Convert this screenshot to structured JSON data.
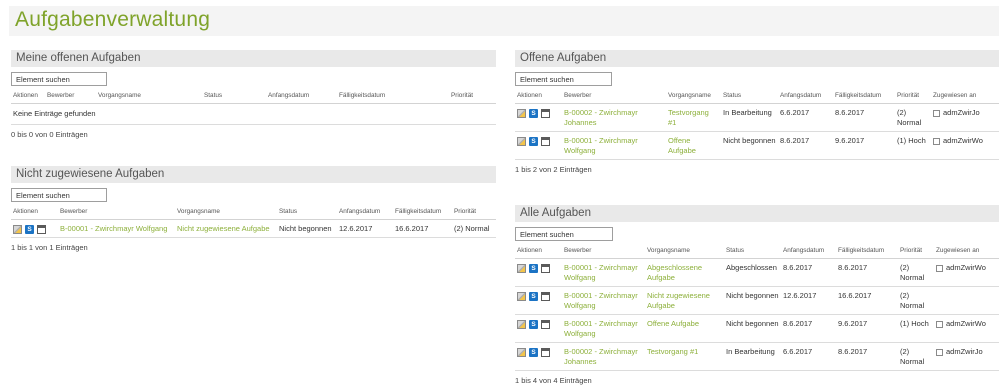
{
  "page": {
    "title": "Aufgabenverwaltung"
  },
  "my_tasks": {
    "title": "Meine offenen Aufgaben",
    "search_placeholder": "Element suchen",
    "columns": [
      "Aktionen",
      "Bewerber",
      "Vorgangsname",
      "Status",
      "Anfangsdatum",
      "Fälligkeitsdatum",
      "Priorität"
    ],
    "empty_text": "Keine Einträge gefunden",
    "footer": "0 bis 0 von 0 Einträgen"
  },
  "unassigned_tasks": {
    "title": "Nicht zugewiesene Aufgaben",
    "search_placeholder": "Element suchen",
    "columns": [
      "Aktionen",
      "Bewerber",
      "Vorgangsname",
      "Status",
      "Anfangsdatum",
      "Fälligkeitsdatum",
      "Priorität"
    ],
    "rows": [
      {
        "applicant": "B-00001 - Zwirchmayr Wolfgang",
        "process": "Nicht zugewiesene Aufgabe",
        "status": "Nicht begonnen",
        "start": "12.6.2017",
        "due": "16.6.2017",
        "priority": "(2) Normal"
      }
    ],
    "footer": "1 bis 1 von 1 Einträgen"
  },
  "open_tasks": {
    "title": "Offene Aufgaben",
    "search_placeholder": "Element suchen",
    "columns": [
      "Aktionen",
      "Bewerber",
      "Vorgangsname",
      "Status",
      "Anfangsdatum",
      "Fälligkeitsdatum",
      "Priorität",
      "Zugewiesen an"
    ],
    "rows": [
      {
        "applicant": "B-00002 - Zwirchmayr Johannes",
        "process": "Testvorgang #1",
        "status": "In Bearbeitung",
        "start": "6.6.2017",
        "due": "8.6.2017",
        "priority": "(2) Normal",
        "assigned": "admZwirJo"
      },
      {
        "applicant": "B-00001 - Zwirchmayr Wolfgang",
        "process": "Offene Aufgabe",
        "status": "Nicht begonnen",
        "start": "8.6.2017",
        "due": "9.6.2017",
        "priority": "(1) Hoch",
        "assigned": "admZwirWo"
      }
    ],
    "footer": "1 bis 2 von 2 Einträgen"
  },
  "all_tasks": {
    "title": "Alle Aufgaben",
    "search_placeholder": "Element suchen",
    "columns": [
      "Aktionen",
      "Bewerber",
      "Vorgangsname",
      "Status",
      "Anfangsdatum",
      "Fälligkeitsdatum",
      "Priorität",
      "Zugewiesen an"
    ],
    "rows": [
      {
        "applicant": "B-00001 - Zwirchmayr Wolfgang",
        "process": "Abgeschlossene Aufgabe",
        "status": "Abgeschlossen",
        "start": "8.6.2017",
        "due": "8.6.2017",
        "priority": "(2) Normal",
        "assigned": "admZwirWo"
      },
      {
        "applicant": "B-00001 - Zwirchmayr Wolfgang",
        "process": "Nicht zugewiesene Aufgabe",
        "status": "Nicht begonnen",
        "start": "12.6.2017",
        "due": "16.6.2017",
        "priority": "(2) Normal",
        "assigned": ""
      },
      {
        "applicant": "B-00001 - Zwirchmayr Wolfgang",
        "process": "Offene Aufgabe",
        "status": "Nicht begonnen",
        "start": "8.6.2017",
        "due": "9.6.2017",
        "priority": "(1) Hoch",
        "assigned": "admZwirWo"
      },
      {
        "applicant": "B-00002 - Zwirchmayr Johannes",
        "process": "Testvorgang #1",
        "status": "In Bearbeitung",
        "start": "6.6.2017",
        "due": "8.6.2017",
        "priority": "(2) Normal",
        "assigned": "admZwirJo"
      }
    ],
    "footer": "1 bis 4 von 4 Einträgen"
  },
  "icons": {
    "edit": "edit-task-icon",
    "sharepoint": "sharepoint-icon",
    "calendar": "calendar-icon"
  },
  "colors": {
    "link": "#8db03b",
    "title": "#7fa32a",
    "header_bg": "#e9e9e9"
  }
}
